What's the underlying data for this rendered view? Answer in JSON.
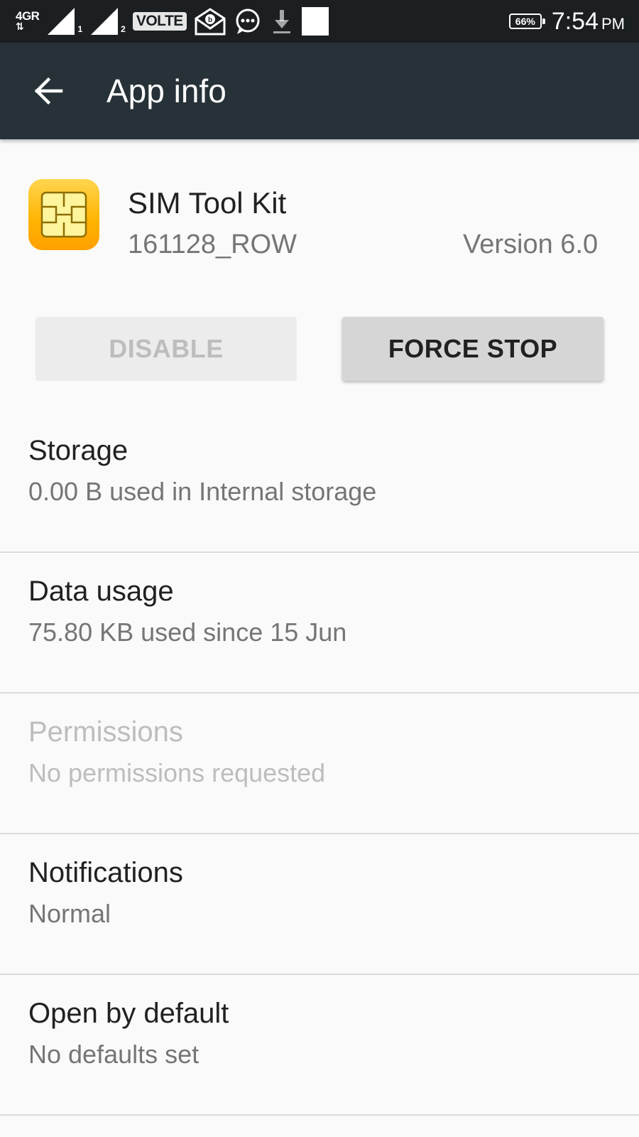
{
  "status_bar": {
    "network_label": "4GR",
    "sim1_index": "1",
    "sim2_index": "2",
    "volte_label": "VOLTE",
    "battery_percent": "66%",
    "time": "7:54",
    "ampm": "PM",
    "icons": [
      "signal-icon",
      "signal-icon",
      "mail-notification-icon",
      "chat-bubble-icon",
      "download-icon"
    ]
  },
  "app_bar": {
    "title": "App info",
    "background_color": "#263238"
  },
  "app": {
    "name": "SIM Tool Kit",
    "build": "161128_ROW",
    "version": "Version 6.0",
    "icon": "sim-card-icon"
  },
  "buttons": {
    "disable": "DISABLE",
    "force_stop": "FORCE STOP"
  },
  "list": [
    {
      "title": "Storage",
      "summary": "0.00 B used in Internal storage",
      "enabled": true
    },
    {
      "title": "Data usage",
      "summary": "75.80 KB used since 15 Jun",
      "enabled": true
    },
    {
      "title": "Permissions",
      "summary": "No permissions requested",
      "enabled": false
    },
    {
      "title": "Notifications",
      "summary": "Normal",
      "enabled": true
    },
    {
      "title": "Open by default",
      "summary": "No defaults set",
      "enabled": true
    }
  ]
}
